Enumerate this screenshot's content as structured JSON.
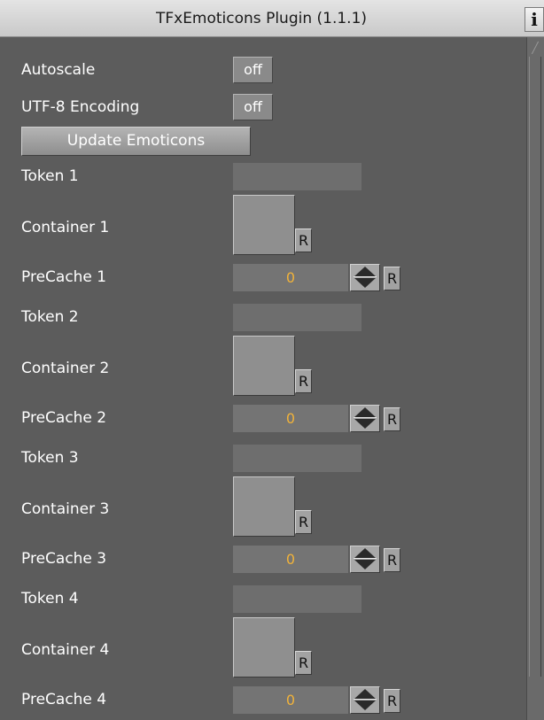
{
  "window": {
    "title": "TFxEmoticons Plugin (1.1.1)",
    "info_label": "i"
  },
  "settings": {
    "autoscale": {
      "label": "Autoscale",
      "value": "off"
    },
    "utf8": {
      "label": "UTF-8 Encoding",
      "value": "off"
    },
    "update_button": "Update Emoticons"
  },
  "groups": [
    {
      "token_label": "Token  1",
      "container_label": "Container  1",
      "precache_label": "PreCache  1",
      "precache_value": "0",
      "reset_label": "R"
    },
    {
      "token_label": "Token  2",
      "container_label": "Container  2",
      "precache_label": "PreCache  2",
      "precache_value": "0",
      "reset_label": "R"
    },
    {
      "token_label": "Token  3",
      "container_label": "Container  3",
      "precache_label": "PreCache  3",
      "precache_value": "0",
      "reset_label": "R"
    },
    {
      "token_label": "Token  4",
      "container_label": "Container  4",
      "precache_label": "PreCache  4",
      "precache_value": "0",
      "reset_label": "R"
    }
  ],
  "colors": {
    "panel_bg": "#5c5c5c",
    "precache_value": "#f0b23a",
    "title_bg": "#d6d6d6"
  },
  "icons": {
    "info": "info-icon",
    "spinner": "up-down-arrows-icon",
    "scroll": "scroll-up-arrow-icon"
  }
}
